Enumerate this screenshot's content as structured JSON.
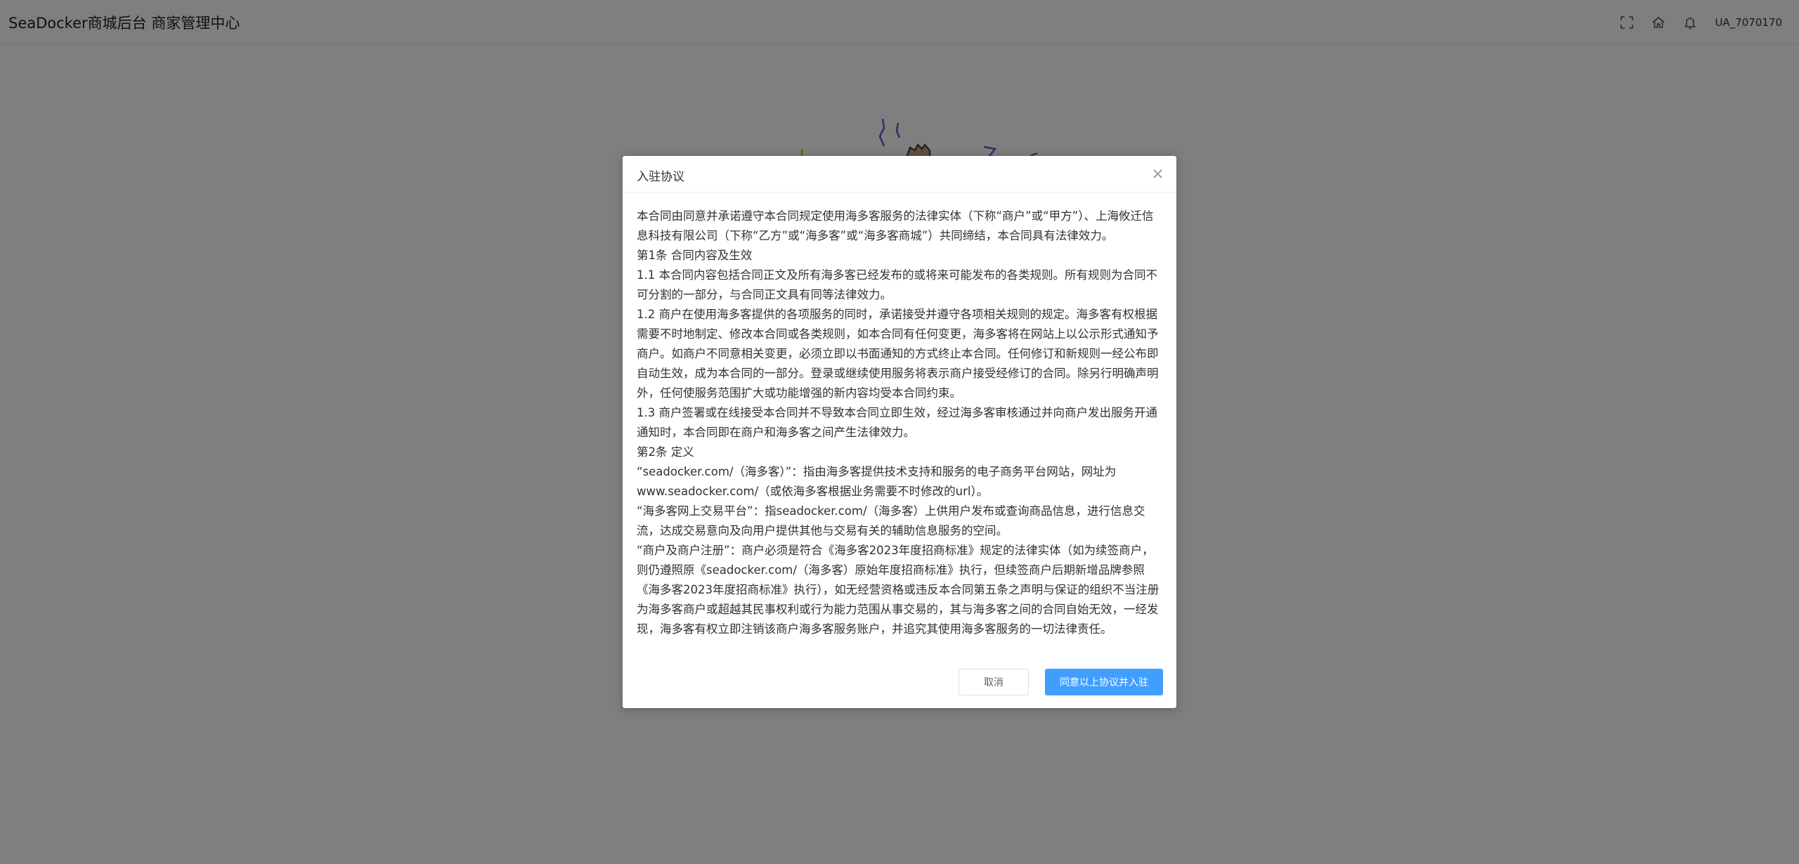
{
  "header": {
    "title": "SeaDocker商城后台 商家管理中心",
    "username": "UA_7070170",
    "icons": [
      "fullscreen-icon",
      "home-icon",
      "bell-icon"
    ]
  },
  "dialog": {
    "title": "入驻协议",
    "cancel_label": "取消",
    "agree_label": "同意以上协议并入驻",
    "paragraphs": [
      "本合同由同意并承诺遵守本合同规定使用海多客服务的法律实体（下称“商户”或“甲方”）、上海攸迁信息科技有限公司（下称“乙方”或“海多客”或“海多客商城”）共同缔结，本合同具有法律效力。",
      "第1条  合同内容及生效",
      "1.1 本合同内容包括合同正文及所有海多客已经发布的或将来可能发布的各类规则。所有规则为合同不可分割的一部分，与合同正文具有同等法律效力。",
      "1.2 商户在使用海多客提供的各项服务的同时，承诺接受并遵守各项相关规则的规定。海多客有权根据需要不时地制定、修改本合同或各类规则，如本合同有任何变更，海多客将在网站上以公示形式通知予商户。如商户不同意相关变更，必须立即以书面通知的方式终止本合同。任何修订和新规则一经公布即自动生效，成为本合同的一部分。登录或继续使用服务将表示商户接受经修订的合同。除另行明确声明外，任何使服务范围扩大或功能增强的新内容均受本合同约束。",
      "1.3 商户签署或在线接受本合同并不导致本合同立即生效，经过海多客审核通过并向商户发出服务开通通知时，本合同即在商户和海多客之间产生法律效力。",
      "第2条  定义",
      "“seadocker.com/（海多客）”：指由海多客提供技术支持和服务的电子商务平台网站，网址为www.seadocker.com/（或依海多客根据业务需要不时修改的url）。",
      "“海多客网上交易平台”：指seadocker.com/（海多客）上供用户发布或查询商品信息，进行信息交流，达成交易意向及向用户提供其他与交易有关的辅助信息服务的空间。",
      "“商户及商户注册”：商户必须是符合《海多客2023年度招商标准》规定的法律实体（如为续签商户，则仍遵照原《seadocker.com/（海多客）原始年度招商标准》执行，但续签商户后期新增品牌参照《海多客2023年度招商标准》执行），如无经营资格或违反本合同第五条之声明与保证的组织不当注册为海多客商户或超越其民事权利或行为能力范围从事交易的，其与海多客之间的合同自始无效，一经发现，海多客有权立即注销该商户海多客服务账户，并追究其使用海多客服务的一切法律责任。"
    ]
  }
}
